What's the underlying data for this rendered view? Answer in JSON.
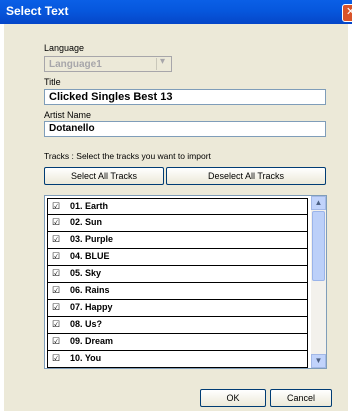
{
  "window": {
    "title": "Select Text"
  },
  "language": {
    "label": "Language",
    "value": "Language1"
  },
  "title": {
    "label": "Title",
    "value": "Clicked Singles Best 13"
  },
  "artist": {
    "label": "Artist Name",
    "value": "Dotanello"
  },
  "tracks": {
    "instruction": "Tracks  : Select the tracks you want to import",
    "select_all_label": "Select All Tracks",
    "deselect_all_label": "Deselect All Tracks",
    "items": [
      {
        "label": "01.  Earth",
        "checked": true
      },
      {
        "label": "02.  Sun",
        "checked": true
      },
      {
        "label": "03.  Purple",
        "checked": true
      },
      {
        "label": "04.  BLUE",
        "checked": true
      },
      {
        "label": "05.  Sky",
        "checked": true
      },
      {
        "label": "06.  Rains",
        "checked": true
      },
      {
        "label": "07.  Happy",
        "checked": true
      },
      {
        "label": "08.  Us?",
        "checked": true
      },
      {
        "label": "09.  Dream",
        "checked": true
      },
      {
        "label": "10.  You",
        "checked": true
      }
    ]
  },
  "buttons": {
    "ok_label": "OK",
    "cancel_label": "Cancel"
  }
}
